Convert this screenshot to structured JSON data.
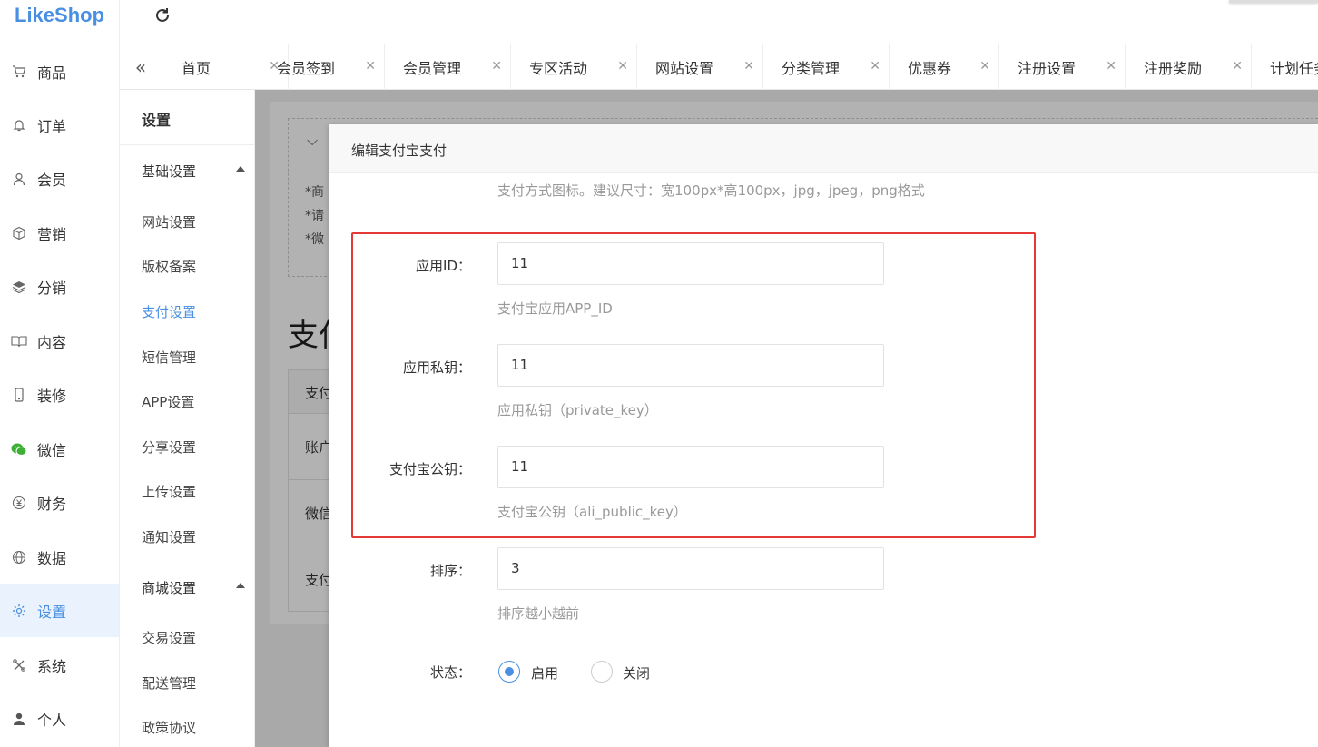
{
  "app": {
    "logo": "LikeShop"
  },
  "main_nav": [
    {
      "label": "商品",
      "icon": "cart-icon"
    },
    {
      "label": "订单",
      "icon": "bell-icon"
    },
    {
      "label": "会员",
      "icon": "user-icon"
    },
    {
      "label": "营销",
      "icon": "box-icon"
    },
    {
      "label": "分销",
      "icon": "layers-icon"
    },
    {
      "label": "内容",
      "icon": "book-icon"
    },
    {
      "label": "装修",
      "icon": "phone-icon"
    },
    {
      "label": "微信",
      "icon": "wechat-icon"
    },
    {
      "label": "财务",
      "icon": "yen-icon"
    },
    {
      "label": "数据",
      "icon": "globe-icon"
    },
    {
      "label": "设置",
      "icon": "gear-icon",
      "active": true
    },
    {
      "label": "系统",
      "icon": "tools-icon"
    },
    {
      "label": "个人",
      "icon": "person-icon"
    }
  ],
  "tabs": [
    "首页",
    "会员签到",
    "会员管理",
    "专区活动",
    "网站设置",
    "分类管理",
    "优惠券",
    "注册设置",
    "注册奖励",
    "计划任务"
  ],
  "sub_nav": {
    "title": "设置",
    "groups": [
      {
        "label": "基础设置",
        "items": [
          "网站设置",
          "版权备案",
          "支付设置",
          "短信管理",
          "APP设置",
          "分享设置",
          "上传设置",
          "通知设置"
        ]
      },
      {
        "label": "商城设置",
        "items": [
          "交易设置",
          "配送管理",
          "政策协议"
        ]
      }
    ],
    "active_item": "支付设置"
  },
  "background": {
    "tips": [
      "*商",
      "*请",
      "*微"
    ],
    "page_title": "支付",
    "table_rows": [
      "支付",
      "账户",
      "微信",
      "支付"
    ]
  },
  "modal": {
    "title": "编辑支付宝支付",
    "icon_hint": "支付方式图标。建议尺寸：宽100px*高100px，jpg，jpeg，png格式",
    "fields": [
      {
        "label": "应用ID：",
        "value": "11",
        "hint": "支付宝应用APP_ID"
      },
      {
        "label": "应用私钥：",
        "value": "11",
        "hint": "应用私钥（private_key）"
      },
      {
        "label": "支付宝公钥：",
        "value": "11",
        "hint": "支付宝公钥（ali_public_key）"
      },
      {
        "label": "排序：",
        "value": "3",
        "hint": "排序越小越前"
      }
    ],
    "status": {
      "label": "状态：",
      "options": [
        "启用",
        "关闭"
      ],
      "selected": "启用"
    }
  },
  "colors": {
    "accent": "#4a90e2",
    "highlight_box": "#e53935"
  }
}
